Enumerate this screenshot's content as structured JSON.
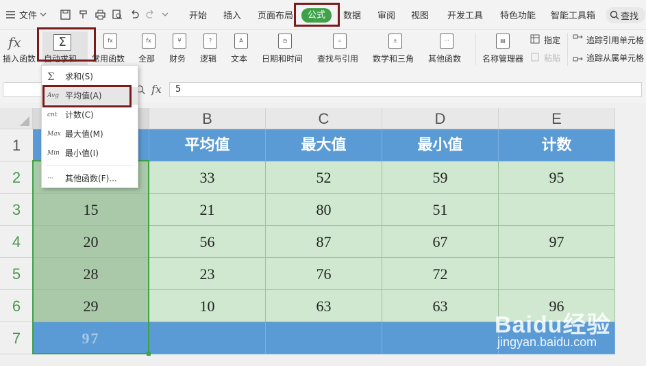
{
  "menubar": {
    "file_label": "文件",
    "tabs": [
      "开始",
      "插入",
      "页面布局",
      "公式",
      "数据",
      "审阅",
      "视图",
      "开发工具",
      "特色功能",
      "智能工具箱"
    ],
    "active_tab": "公式",
    "search_label": "查找"
  },
  "ribbon": {
    "insert_function": "插入函数",
    "autosum": "自动求和",
    "common_functions": "常用函数",
    "all": "全部",
    "finance": "财务",
    "logic": "逻辑",
    "text": "文本",
    "datetime": "日期和时间",
    "lookup": "查找与引用",
    "math": "数学和三角",
    "other": "其他函数",
    "name_manager": "名称管理器",
    "specify": "指定",
    "paste": "粘贴",
    "trace_precedents": "追踪引用单元格",
    "trace_dependents": "追踪从属单元格"
  },
  "formula_bar": {
    "fx_label": "fx",
    "value": "5"
  },
  "dropdown": {
    "items": [
      {
        "icon": "Σ",
        "label": "求和(S)"
      },
      {
        "icon": "Avg",
        "label": "平均值(A)"
      },
      {
        "icon": "cnt",
        "label": "计数(C)"
      },
      {
        "icon": "Max",
        "label": "最大值(M)"
      },
      {
        "icon": "Min",
        "label": "最小值(I)"
      },
      {
        "icon": "···",
        "label": "其他函数(F)..."
      }
    ]
  },
  "sheet": {
    "columns": [
      "B",
      "C",
      "D",
      "E"
    ],
    "rows": [
      "1",
      "2",
      "3",
      "4",
      "5",
      "6",
      "7"
    ],
    "headers": [
      "平均值",
      "最大值",
      "最小值",
      "计数"
    ],
    "col_a": [
      "",
      "15",
      "20",
      "28",
      "29"
    ],
    "data": [
      [
        "33",
        "52",
        "59",
        "95"
      ],
      [
        "21",
        "80",
        "51",
        ""
      ],
      [
        "56",
        "87",
        "67",
        "97"
      ],
      [
        "23",
        "76",
        "72",
        ""
      ],
      [
        "10",
        "63",
        "63",
        "96"
      ]
    ],
    "total_a": "97"
  },
  "watermark": {
    "brand": "Baidu经验",
    "url": "jingyan.baidu.com"
  },
  "colors": {
    "active_tab": "#3fa24a",
    "header_fill": "#5b9bd5",
    "data_fill": "#cfe8cf",
    "highlight_border": "#7a1b1b"
  }
}
